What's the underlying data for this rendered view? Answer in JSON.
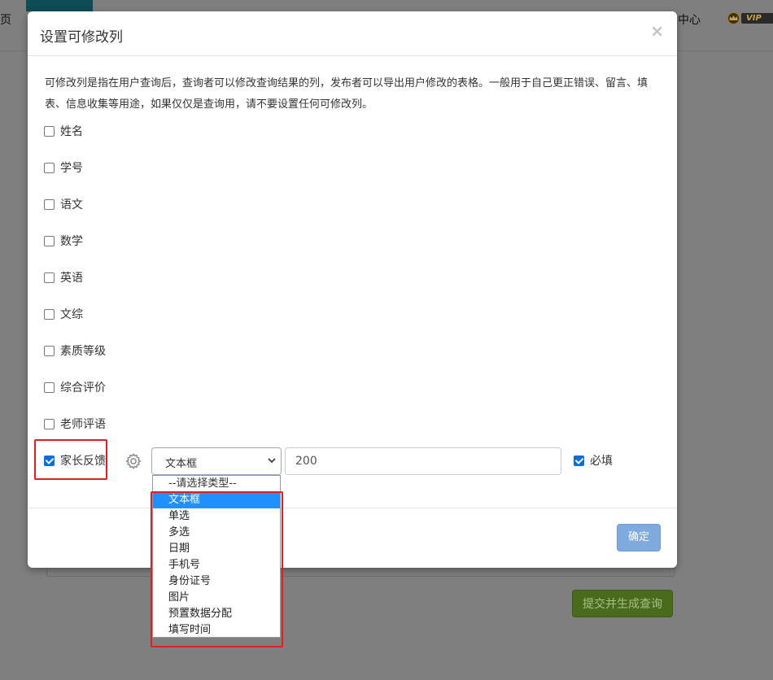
{
  "background": {
    "nav_left_fragment": "页",
    "nav_right_fragment": "中心",
    "vip_label": "VIP",
    "submit_button": "提交并生成查询",
    "submit_color": "#4a6b1b"
  },
  "modal": {
    "title": "设置可修改列",
    "close_symbol": "×",
    "description": "可修改列是指在用户查询后，查询者可以修改查询结果的列，发布者可以导出用户修改的表格。一般用于自己更正错误、留言、填表、信息收集等用途，如果仅仅是查询用，请不要设置任何可修改列。",
    "columns": [
      {
        "label": "姓名",
        "checked": false
      },
      {
        "label": "学号",
        "checked": false
      },
      {
        "label": "语文",
        "checked": false
      },
      {
        "label": "数学",
        "checked": false
      },
      {
        "label": "英语",
        "checked": false
      },
      {
        "label": "文综",
        "checked": false
      },
      {
        "label": "素质等级",
        "checked": false
      },
      {
        "label": "综合评价",
        "checked": false
      },
      {
        "label": "老师评语",
        "checked": false
      },
      {
        "label": "家长反馈",
        "checked": true
      }
    ],
    "editor": {
      "settings_icon": "gear-icon",
      "type_select_value": "文本框",
      "max_length_value": "200",
      "required_label": "必填",
      "required_checked": true
    },
    "confirm_button": "确定",
    "confirm_color": "#7faadd"
  },
  "dropdown": {
    "options": [
      "--请选择类型--",
      "文本框",
      "单选",
      "多选",
      "日期",
      "手机号",
      "身份证号",
      "图片",
      "预置数据分配",
      "填写时间"
    ],
    "selected": "文本框",
    "highlight_color": "#1e90ff"
  },
  "annotation_color": "#e02020"
}
